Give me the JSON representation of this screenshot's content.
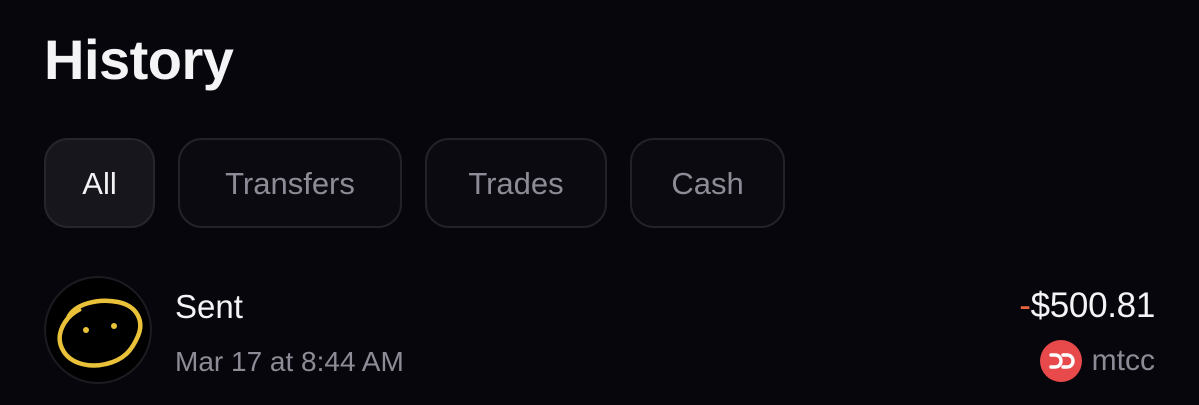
{
  "header": {
    "title": "History"
  },
  "filters": [
    {
      "label": "All",
      "active": true
    },
    {
      "label": "Transfers",
      "active": false
    },
    {
      "label": "Trades",
      "active": false
    },
    {
      "label": "Cash",
      "active": false
    }
  ],
  "transactions": [
    {
      "title": "Sent",
      "date": "Mar 17 at 8:44 AM",
      "amount_sign": "-",
      "amount_value": "$500.81",
      "recipient": "mtcc",
      "avatar_icon": "potato-doodle-icon",
      "recipient_icon": "mtcc-logo-icon"
    }
  ],
  "colors": {
    "background": "#07060c",
    "negative_sign": "#e9653e",
    "recipient_badge": "#e8494b",
    "avatar_doodle": "#e9c23a"
  }
}
